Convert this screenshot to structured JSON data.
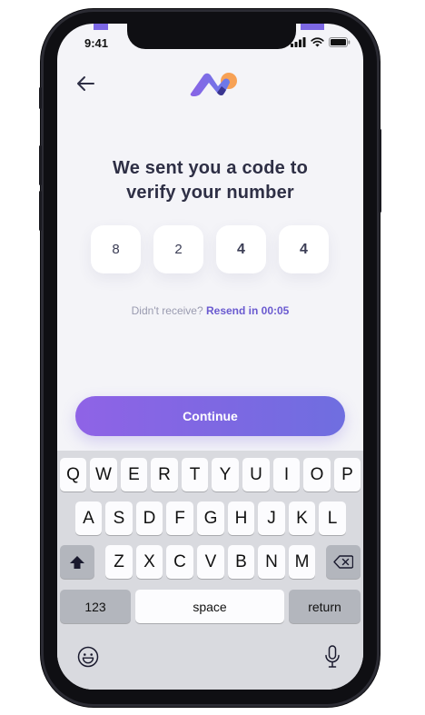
{
  "status_bar": {
    "time": "9:41"
  },
  "header": {
    "back_icon": "arrow-left-icon",
    "logo_icon": "brand-logo-icon"
  },
  "title": {
    "line1": "We sent you a code to",
    "line2": "verify your number"
  },
  "code_digits": [
    "8",
    "2",
    "4",
    "4"
  ],
  "resend": {
    "prefix": "Didn't receive?",
    "action": "Resend in 00:05"
  },
  "continue_label": "Continue",
  "keyboard": {
    "row1": [
      "Q",
      "W",
      "E",
      "R",
      "T",
      "Y",
      "U",
      "I",
      "O",
      "P"
    ],
    "row2": [
      "A",
      "S",
      "D",
      "F",
      "G",
      "H",
      "J",
      "K",
      "L"
    ],
    "row3": [
      "Z",
      "X",
      "C",
      "V",
      "B",
      "N",
      "M"
    ],
    "numbers_label": "123",
    "space_label": "space",
    "return_label": "return"
  },
  "colors": {
    "accent": "#7c67e4",
    "title": "#2e2f45",
    "resend_link": "#6a5ad0"
  }
}
